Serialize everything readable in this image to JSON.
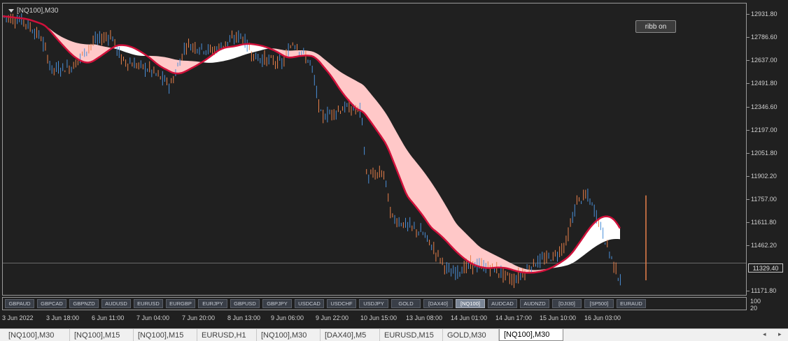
{
  "chart": {
    "title": "[NQ100],M30",
    "ribbon_button": "ribb on",
    "current_price": "11329.40",
    "price_labels": [
      "12931.80",
      "12786.60",
      "12637.00",
      "12491.80",
      "12346.60",
      "12197.00",
      "12051.80",
      "11902.20",
      "11757.00",
      "11611.80",
      "11462.20",
      "11329.40",
      "11171.80"
    ],
    "sub_axis_labels": [
      "100",
      "20"
    ],
    "time_labels": [
      "3 Jun 2022",
      "3 Jun 18:00",
      "6 Jun 11:00",
      "7 Jun 04:00",
      "7 Jun 20:00",
      "8 Jun 13:00",
      "9 Jun 06:00",
      "9 Jun 22:00",
      "10 Jun 15:00",
      "13 Jun 08:00",
      "14 Jun 01:00",
      "14 Jun 17:00",
      "15 Jun 10:00",
      "16 Jun 03:00"
    ],
    "colors": {
      "bull": "#4a8fd8",
      "bear": "#e8804a",
      "ma_fast": "#d0103a",
      "ma_slow": "#106a10",
      "fill_up": "#ffffff",
      "fill_down": "#ffc8c8"
    }
  },
  "chart_data": {
    "type": "candlestick",
    "symbol": "[NQ100]",
    "timeframe": "M30",
    "ylim": [
      11171.8,
      12931.8
    ],
    "overlays": [
      "fast moving average",
      "slow moving average",
      "ribbon fill"
    ],
    "current_price": 11329.4
  },
  "symbol_buttons": [
    {
      "label": "GBPAUD",
      "active": false
    },
    {
      "label": "GBPCAD",
      "active": false
    },
    {
      "label": "GBPNZD",
      "active": false
    },
    {
      "label": "AUDUSD",
      "active": false
    },
    {
      "label": "EURUSD",
      "active": false
    },
    {
      "label": "EURGBP",
      "active": false
    },
    {
      "label": "EURJPY",
      "active": false
    },
    {
      "label": "GBPUSD",
      "active": false
    },
    {
      "label": "GBPJPY",
      "active": false
    },
    {
      "label": "USDCAD",
      "active": false
    },
    {
      "label": "USDCHF",
      "active": false
    },
    {
      "label": "USDJPY",
      "active": false
    },
    {
      "label": "GOLD",
      "active": false
    },
    {
      "label": "[DAX40]",
      "active": false
    },
    {
      "label": "[NQ100]",
      "active": true
    },
    {
      "label": "AUDCAD",
      "active": false
    },
    {
      "label": "AUDNZD",
      "active": false
    },
    {
      "label": "[DJI30]",
      "active": false
    },
    {
      "label": "[SP500]",
      "active": false
    },
    {
      "label": "EURAUD",
      "active": false
    }
  ],
  "tabs": [
    {
      "label": "[NQ100],M30",
      "active": false
    },
    {
      "label": "[NQ100],M15",
      "active": false
    },
    {
      "label": "[NQ100],M15",
      "active": false
    },
    {
      "label": "EURUSD,H1",
      "active": false
    },
    {
      "label": "[NQ100],M30",
      "active": false
    },
    {
      "label": "[DAX40],M5",
      "active": false
    },
    {
      "label": "EURUSD,M15",
      "active": false
    },
    {
      "label": "GOLD,M30",
      "active": false
    },
    {
      "label": "[NQ100],M30",
      "active": true
    }
  ],
  "scroll": {
    "left": "◂",
    "right": "▸"
  }
}
